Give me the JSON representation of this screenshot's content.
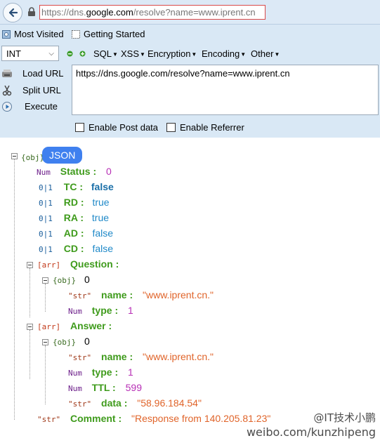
{
  "browser": {
    "url_prefix": "https://dns.",
    "url_domain": "google.com",
    "url_suffix": "/resolve?name=www.iprent.cn",
    "bookmarks": [
      "Most Visited",
      "Getting Started"
    ]
  },
  "hackbar": {
    "select_value": "INT",
    "menus": [
      "SQL",
      "XSS",
      "Encryption",
      "Encoding",
      "Other"
    ],
    "load_url": "Load URL",
    "split_url": "Split URL",
    "execute": "Execute",
    "url_text": "https://dns.google.com/resolve?name=www.iprent.cn",
    "enable_post": "Enable Post data",
    "enable_referrer": "Enable Referrer"
  },
  "tree": {
    "root_tag": "{obj}",
    "badge": "JSON",
    "rows": [
      {
        "tag": "Num",
        "key": "Status :",
        "value": "0"
      },
      {
        "tag": "0|1",
        "key": "TC :",
        "value": "false"
      },
      {
        "tag": "0|1",
        "key": "RD :",
        "value": "true"
      },
      {
        "tag": "0|1",
        "key": "RA :",
        "value": "true"
      },
      {
        "tag": "0|1",
        "key": "AD :",
        "value": "false"
      },
      {
        "tag": "0|1",
        "key": "CD :",
        "value": "false"
      }
    ],
    "question": {
      "tag": "[arr]",
      "key": "Question :",
      "obj_tag": "{obj}",
      "index": "0",
      "items": [
        {
          "tag": "\"str\"",
          "key": "name :",
          "value": "\"www.iprent.cn.\""
        },
        {
          "tag": "Num",
          "key": "type :",
          "value": "1"
        }
      ]
    },
    "answer": {
      "tag": "[arr]",
      "key": "Answer :",
      "obj_tag": "{obj}",
      "index": "0",
      "items": [
        {
          "tag": "\"str\"",
          "key": "name :",
          "value": "\"www.iprent.cn.\""
        },
        {
          "tag": "Num",
          "key": "type :",
          "value": "1"
        },
        {
          "tag": "Num",
          "key": "TTL :",
          "value": "599"
        },
        {
          "tag": "\"str\"",
          "key": "data :",
          "value": "\"58.96.184.54\""
        }
      ]
    },
    "comment": {
      "tag": "\"str\"",
      "key": "Comment :",
      "value": "\"Response from 140.205.81.23\""
    }
  },
  "watermark": {
    "handle": "@IT技术小鹏",
    "site": "weibo.com/kunzhipeng"
  }
}
